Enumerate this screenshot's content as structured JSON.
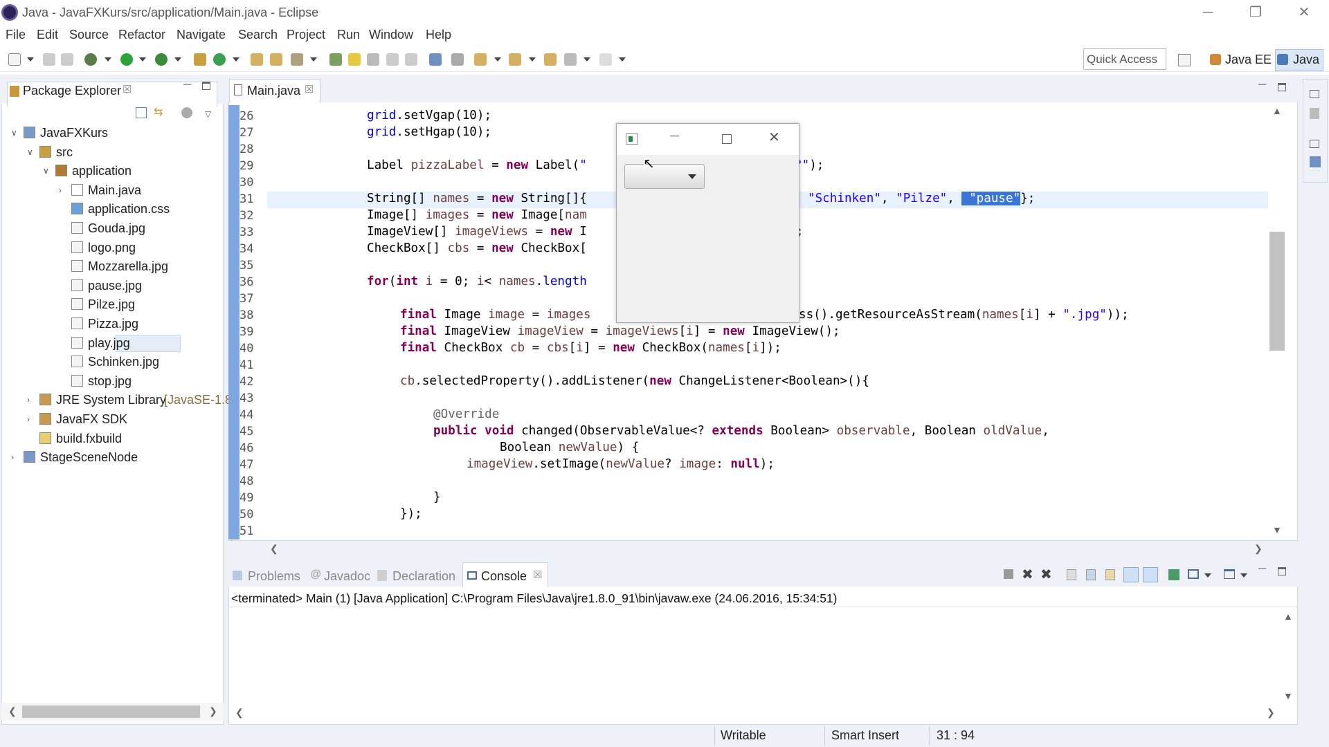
{
  "window": {
    "title": "Java - JavaFXKurs/src/application/Main.java - Eclipse"
  },
  "menu": [
    "File",
    "Edit",
    "Source",
    "Refactor",
    "Navigate",
    "Search",
    "Project",
    "Run",
    "Window",
    "Help"
  ],
  "toolbar": {
    "quick_access": "Quick Access",
    "perspectives": {
      "java_ee": "Java EE",
      "java": "Java"
    }
  },
  "package_explorer": {
    "tab_label": "Package Explorer",
    "tree": [
      {
        "label": "JavaFXKurs",
        "depth": 0,
        "expanded": true,
        "icon": "project-icon"
      },
      {
        "label": "src",
        "depth": 1,
        "expanded": true,
        "icon": "source-folder-icon"
      },
      {
        "label": "application",
        "depth": 2,
        "expanded": true,
        "icon": "package-icon"
      },
      {
        "label": "Main.java",
        "depth": 3,
        "expanded": false,
        "icon": "java-file-icon"
      },
      {
        "label": "application.css",
        "depth": 3,
        "icon": "css-file-icon"
      },
      {
        "label": "Gouda.jpg",
        "depth": 3,
        "icon": "file-icon"
      },
      {
        "label": "logo.png",
        "depth": 3,
        "icon": "file-icon"
      },
      {
        "label": "Mozzarella.jpg",
        "depth": 3,
        "icon": "file-icon"
      },
      {
        "label": "pause.jpg",
        "depth": 3,
        "icon": "file-icon"
      },
      {
        "label": "Pilze.jpg",
        "depth": 3,
        "icon": "file-icon"
      },
      {
        "label": "Pizza.jpg",
        "depth": 3,
        "icon": "file-icon"
      },
      {
        "label": "play.jpg",
        "depth": 3,
        "icon": "file-icon",
        "selected": true
      },
      {
        "label": "Schinken.jpg",
        "depth": 3,
        "icon": "file-icon"
      },
      {
        "label": "stop.jpg",
        "depth": 3,
        "icon": "file-icon"
      },
      {
        "label": "JRE System Library",
        "suffix": "[JavaSE-1.8",
        "depth": 1,
        "expanded": false,
        "icon": "library-icon"
      },
      {
        "label": "JavaFX SDK",
        "depth": 1,
        "expanded": false,
        "icon": "library-icon"
      },
      {
        "label": "build.fxbuild",
        "depth": 1,
        "icon": "fxbuild-file-icon"
      },
      {
        "label": "StageSceneNode",
        "depth": 0,
        "expanded": false,
        "icon": "project-icon"
      }
    ]
  },
  "editor": {
    "tab_label": "Main.java",
    "line_numbers": [
      "26",
      "27",
      "28",
      "29",
      "30",
      "31",
      "32",
      "33",
      "34",
      "35",
      "36",
      "37",
      "38",
      "39",
      "40",
      "41",
      "42",
      "43",
      "44",
      "45",
      "46",
      "47",
      "48",
      "49",
      "50",
      "51"
    ]
  },
  "popup": {
    "title": ""
  },
  "console": {
    "tabs": [
      "Problems",
      "Javadoc",
      "Declaration",
      "Console"
    ],
    "output": "<terminated> Main (1) [Java Application] C:\\Program Files\\Java\\jre1.8.0_91\\bin\\javaw.exe (24.06.2016, 15:34:51)"
  },
  "status": {
    "mode": "Writable",
    "insert": "Smart Insert",
    "position": "31 : 94"
  }
}
